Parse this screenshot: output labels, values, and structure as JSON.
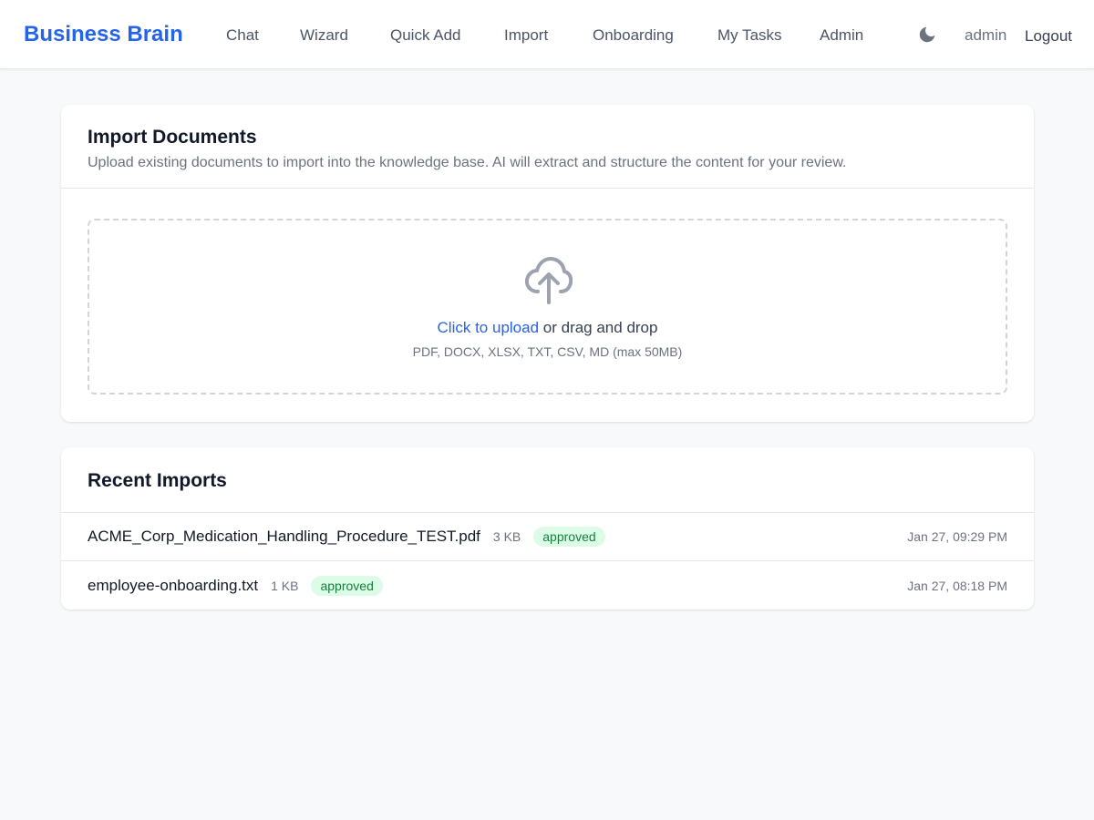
{
  "app": {
    "brand": "Business Brain"
  },
  "nav": {
    "items": [
      "Chat",
      "Wizard",
      "Quick Add",
      "Import",
      "Onboarding",
      "My Tasks",
      "Admin"
    ],
    "theme_icon": "moon-icon",
    "user": "admin",
    "logout": "Logout"
  },
  "import_card": {
    "title": "Import Documents",
    "subtitle": "Upload existing documents to import into the knowledge base. AI will extract and structure the content for your review.",
    "upload_icon": "cloud-upload-icon",
    "upload_link": "Click to upload",
    "upload_rest": " or drag and drop",
    "upload_hint": "PDF, DOCX, XLSX, TXT, CSV, MD (max 50MB)"
  },
  "recent": {
    "title": "Recent Imports",
    "rows": [
      {
        "name": "ACME_Corp_Medication_Handling_Procedure_TEST.pdf",
        "size": "3 KB",
        "status": "approved",
        "date": "Jan 27, 09:29 PM"
      },
      {
        "name": "employee-onboarding.txt",
        "size": "1 KB",
        "status": "approved",
        "date": "Jan 27, 08:18 PM"
      }
    ]
  },
  "colors": {
    "accent": "#2563eb",
    "background": "#f8f9fb",
    "badge_bg": "#dcfce7",
    "badge_text": "#15803d"
  }
}
